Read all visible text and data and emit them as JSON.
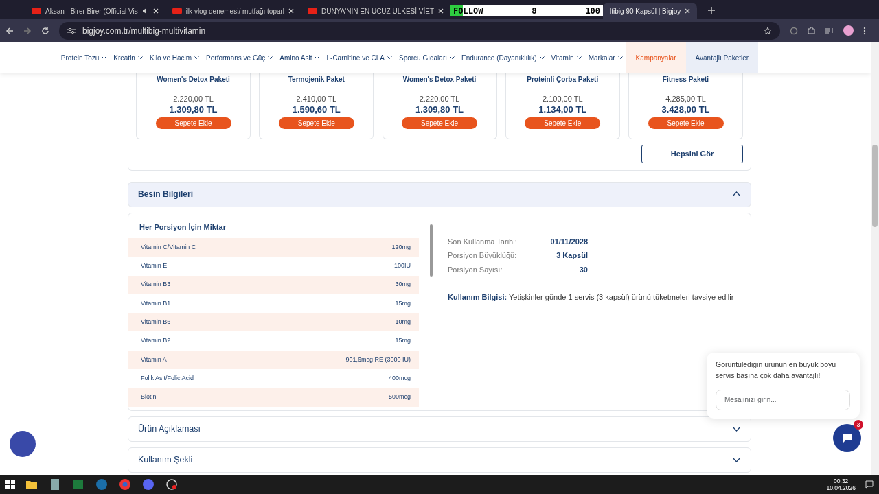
{
  "browser": {
    "tabs": [
      {
        "title": "Aksan - Birer Birer (Official Vis",
        "audio": true,
        "selected": false
      },
      {
        "title": "ilk vlog denemesi/ mutfağı toparl",
        "selected": false
      },
      {
        "title": "DÜNYA'NIN EN UCUZ ÜLKESİ VİET",
        "selected": false
      },
      {
        "title": "ltibig 90 Kapsül | Bigjoy",
        "selected": true
      }
    ],
    "url": "bigjoy.com.tr/multibig-multivitamin"
  },
  "follow_overlay": {
    "label": "FOLLOW",
    "count": "8",
    "goal": "100",
    "level": 0.08
  },
  "nav": [
    {
      "label": "Protein Tozu",
      "kind": "menu"
    },
    {
      "label": "Kreatin",
      "kind": "menu"
    },
    {
      "label": "Kilo ve Hacim",
      "kind": "menu"
    },
    {
      "label": "Performans ve Güç",
      "kind": "menu"
    },
    {
      "label": "Amino Asit",
      "kind": "menu"
    },
    {
      "label": "L-Carnitine ve CLA",
      "kind": "menu"
    },
    {
      "label": "Sporcu Gıdaları",
      "kind": "menu"
    },
    {
      "label": "Endurance (Dayanıklılık)",
      "kind": "menu"
    },
    {
      "label": "Vitamin",
      "kind": "menu"
    },
    {
      "label": "Markalar",
      "kind": "menu"
    },
    {
      "label": "Kampanyalar",
      "kind": "campaign"
    },
    {
      "label": "Avantajlı Paketler",
      "kind": "package"
    }
  ],
  "products": [
    {
      "name": "Women's Detox Paketi",
      "old_price": "2.220,00 TL",
      "price": "1.309,80 TL",
      "button": "Sepete Ekle"
    },
    {
      "name": "Termojenik Paket",
      "old_price": "2.410,00 TL",
      "price": "1.590,60 TL",
      "button": "Sepete Ekle"
    },
    {
      "name": "Women's Detox Paketi",
      "old_price": "2.220,00 TL",
      "price": "1.309,80 TL",
      "button": "Sepete Ekle"
    },
    {
      "name": "Proteinli Çorba Paketi",
      "old_price": "2.100,00 TL",
      "price": "1.134,00 TL",
      "button": "Sepete Ekle"
    },
    {
      "name": "Fitness Paketi",
      "old_price": "4.285,00 TL",
      "price": "3.428,00 TL",
      "button": "Sepete Ekle"
    }
  ],
  "see_all": "Hepsini Gör",
  "nutrition": {
    "title": "Besin Bilgileri",
    "expanded": true,
    "table_title": "Her Porsiyon İçin Miktar",
    "rows": [
      {
        "name": "Vitamin C/Vitamin C",
        "amount": "120mg"
      },
      {
        "name": "Vitamin E",
        "amount": "100IU"
      },
      {
        "name": "Vitamin B3",
        "amount": "30mg"
      },
      {
        "name": "Vitamin B1",
        "amount": "15mg"
      },
      {
        "name": "Vitamin B6",
        "amount": "10mg"
      },
      {
        "name": "Vitamin B2",
        "amount": "15mg"
      },
      {
        "name": "Vitamin A",
        "amount": "901,6mcg RE (3000 IU)"
      },
      {
        "name": "Folik Asit/Folic Acid",
        "amount": "400mcg"
      },
      {
        "name": "Biotin",
        "amount": "500mcg"
      }
    ],
    "facts": [
      {
        "label": "Son Kullanma Tarihi:",
        "value": "01/11/2028"
      },
      {
        "label": "Porsiyon Büyüklüğü:",
        "value": "3 Kapsül"
      },
      {
        "label": "Porsiyon Sayısı:",
        "value": "30"
      }
    ],
    "usage_label": "Kullanım Bilgisi:",
    "usage_text": "Yetişkinler günde 1 servis (3 kapsül) ürünü tüketmeleri tavsiye edilir"
  },
  "sections": [
    {
      "title": "Ürün Açıklaması",
      "expanded": false
    },
    {
      "title": "Kullanım Şekli",
      "expanded": false
    }
  ],
  "chat": {
    "message": "Görüntülediğin ürünün en büyük boyu servis başına çok daha avantajlı!",
    "placeholder": "Mesajınızı girin...",
    "badge": "3"
  },
  "taskbar": {
    "time": "00:32",
    "date": "10.04.2026"
  }
}
